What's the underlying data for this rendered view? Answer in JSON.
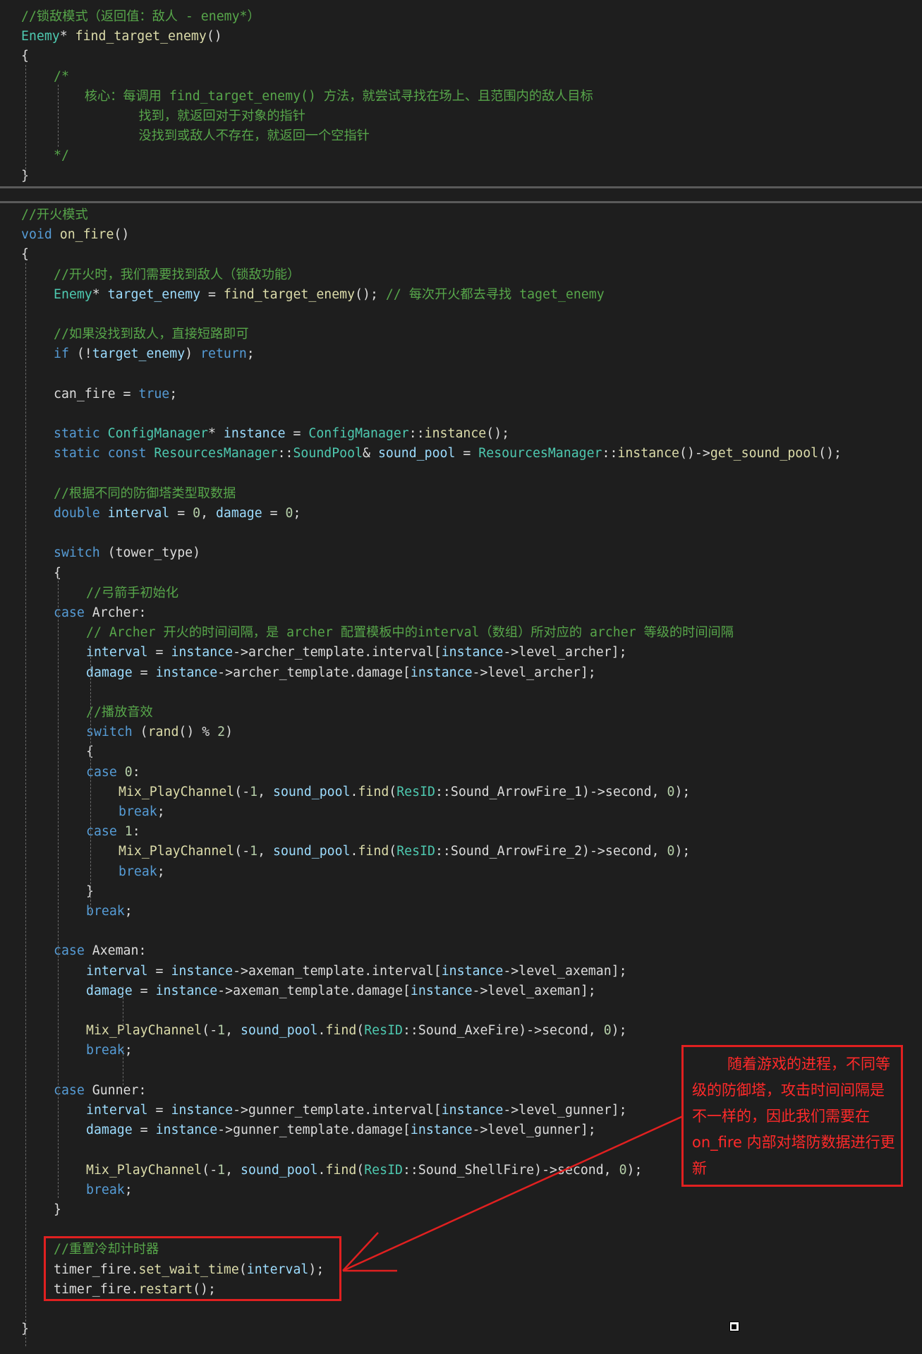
{
  "colors": {
    "background": "#1e1e1e",
    "comment": "#57a64a",
    "keyword": "#569cd6",
    "type": "#4ec9b0",
    "function": "#dcdcaa",
    "variable": "#9cdcfe",
    "plain": "#dcdcdc",
    "number": "#b5cea8",
    "annotation": "#ff2a2a"
  },
  "code_top": [
    {
      "indent": 0,
      "tokens": [
        [
          "comment",
          "//锁敌模式（返回值：敌人 - enemy*）"
        ]
      ]
    },
    {
      "indent": 0,
      "tokens": [
        [
          "type",
          "Enemy"
        ],
        [
          "plain",
          "* "
        ],
        [
          "function",
          "find_target_enemy"
        ],
        [
          "plain",
          "()"
        ]
      ]
    },
    {
      "indent": 0,
      "tokens": [
        [
          "plain",
          "{"
        ]
      ]
    },
    {
      "indent": 1,
      "tokens": [
        [
          "comment",
          "/*"
        ]
      ]
    },
    {
      "indent": 1,
      "tokens": [
        [
          "comment",
          "    核心：每调用 find_target_enemy() 方法，就尝试寻找在场上、且范围内的敌人目标"
        ]
      ]
    },
    {
      "indent": 1,
      "tokens": [
        [
          "comment",
          "           找到，就返回对于对象的指针"
        ]
      ]
    },
    {
      "indent": 1,
      "tokens": [
        [
          "comment",
          "           没找到或敌人不存在，就返回一个空指针"
        ]
      ]
    },
    {
      "indent": 1,
      "tokens": [
        [
          "comment",
          "*/"
        ]
      ]
    },
    {
      "indent": 0,
      "tokens": [
        [
          "plain",
          "}"
        ]
      ]
    }
  ],
  "code_bottom": [
    {
      "indent": 0,
      "tokens": [
        [
          "comment",
          "//开火模式"
        ]
      ]
    },
    {
      "indent": 0,
      "tokens": [
        [
          "keyword",
          "void "
        ],
        [
          "function",
          "on_fire"
        ],
        [
          "plain",
          "()"
        ]
      ]
    },
    {
      "indent": 0,
      "tokens": [
        [
          "plain",
          "{"
        ]
      ]
    },
    {
      "indent": 1,
      "tokens": [
        [
          "comment",
          "//开火时，我们需要找到敌人（锁敌功能）"
        ]
      ]
    },
    {
      "indent": 1,
      "tokens": [
        [
          "type",
          "Enemy"
        ],
        [
          "plain",
          "* "
        ],
        [
          "variable",
          "target_enemy"
        ],
        [
          "plain",
          " = "
        ],
        [
          "function",
          "find_target_enemy"
        ],
        [
          "plain",
          "(); "
        ],
        [
          "comment",
          "// 每次开火都去寻找 taget_enemy"
        ]
      ]
    },
    {
      "indent": 1,
      "tokens": []
    },
    {
      "indent": 1,
      "tokens": [
        [
          "comment",
          "//如果没找到敌人，直接短路即可"
        ]
      ]
    },
    {
      "indent": 1,
      "tokens": [
        [
          "keyword",
          "if "
        ],
        [
          "plain",
          "(!"
        ],
        [
          "variable",
          "target_enemy"
        ],
        [
          "plain",
          ") "
        ],
        [
          "keyword",
          "return"
        ],
        [
          "plain",
          ";"
        ]
      ]
    },
    {
      "indent": 1,
      "tokens": []
    },
    {
      "indent": 1,
      "tokens": [
        [
          "plain",
          "can_fire = "
        ],
        [
          "keyword",
          "true"
        ],
        [
          "plain",
          ";"
        ]
      ]
    },
    {
      "indent": 1,
      "tokens": []
    },
    {
      "indent": 1,
      "tokens": [
        [
          "keyword",
          "static "
        ],
        [
          "type",
          "ConfigManager"
        ],
        [
          "plain",
          "* "
        ],
        [
          "variable",
          "instance"
        ],
        [
          "plain",
          " = "
        ],
        [
          "type",
          "ConfigManager"
        ],
        [
          "plain",
          "::"
        ],
        [
          "function",
          "instance"
        ],
        [
          "plain",
          "();"
        ]
      ]
    },
    {
      "indent": 1,
      "tokens": [
        [
          "keyword",
          "static const "
        ],
        [
          "type",
          "ResourcesManager"
        ],
        [
          "plain",
          "::"
        ],
        [
          "type",
          "SoundPool"
        ],
        [
          "plain",
          "& "
        ],
        [
          "variable",
          "sound_pool"
        ],
        [
          "plain",
          " = "
        ],
        [
          "type",
          "ResourcesManager"
        ],
        [
          "plain",
          "::"
        ],
        [
          "function",
          "instance"
        ],
        [
          "plain",
          "()->"
        ],
        [
          "function",
          "get_sound_pool"
        ],
        [
          "plain",
          "();"
        ]
      ]
    },
    {
      "indent": 1,
      "tokens": []
    },
    {
      "indent": 1,
      "tokens": [
        [
          "comment",
          "//根据不同的防御塔类型取数据"
        ]
      ]
    },
    {
      "indent": 1,
      "tokens": [
        [
          "keyword",
          "double "
        ],
        [
          "variable",
          "interval"
        ],
        [
          "plain",
          " = "
        ],
        [
          "number",
          "0"
        ],
        [
          "plain",
          ", "
        ],
        [
          "variable",
          "damage"
        ],
        [
          "plain",
          " = "
        ],
        [
          "number",
          "0"
        ],
        [
          "plain",
          ";"
        ]
      ]
    },
    {
      "indent": 1,
      "tokens": []
    },
    {
      "indent": 1,
      "tokens": [
        [
          "keyword",
          "switch "
        ],
        [
          "plain",
          "(tower_type)"
        ]
      ]
    },
    {
      "indent": 1,
      "tokens": [
        [
          "plain",
          "{"
        ]
      ]
    },
    {
      "indent": 2,
      "tokens": [
        [
          "comment",
          "//弓箭手初始化"
        ]
      ]
    },
    {
      "indent": 1,
      "tokens": [
        [
          "keyword",
          "case "
        ],
        [
          "plain",
          "Archer:"
        ]
      ]
    },
    {
      "indent": 2,
      "tokens": [
        [
          "comment",
          "// Archer 开火的时间间隔，是 archer 配置模板中的interval（数组）所对应的 archer 等级的时间间隔"
        ]
      ]
    },
    {
      "indent": 2,
      "tokens": [
        [
          "variable",
          "interval"
        ],
        [
          "plain",
          " = "
        ],
        [
          "variable",
          "instance"
        ],
        [
          "plain",
          "->archer_template.interval["
        ],
        [
          "variable",
          "instance"
        ],
        [
          "plain",
          "->level_archer];"
        ]
      ]
    },
    {
      "indent": 2,
      "tokens": [
        [
          "variable",
          "damage"
        ],
        [
          "plain",
          " = "
        ],
        [
          "variable",
          "instance"
        ],
        [
          "plain",
          "->archer_template.damage["
        ],
        [
          "variable",
          "instance"
        ],
        [
          "plain",
          "->level_archer];"
        ]
      ]
    },
    {
      "indent": 2,
      "tokens": []
    },
    {
      "indent": 2,
      "tokens": [
        [
          "comment",
          "//播放音效"
        ]
      ]
    },
    {
      "indent": 2,
      "tokens": [
        [
          "keyword",
          "switch "
        ],
        [
          "plain",
          "("
        ],
        [
          "function",
          "rand"
        ],
        [
          "plain",
          "() % "
        ],
        [
          "number",
          "2"
        ],
        [
          "plain",
          ")"
        ]
      ]
    },
    {
      "indent": 2,
      "tokens": [
        [
          "plain",
          "{"
        ]
      ]
    },
    {
      "indent": 2,
      "tokens": [
        [
          "keyword",
          "case "
        ],
        [
          "number",
          "0"
        ],
        [
          "plain",
          ":"
        ]
      ]
    },
    {
      "indent": 3,
      "tokens": [
        [
          "function",
          "Mix_PlayChannel"
        ],
        [
          "plain",
          "(-"
        ],
        [
          "number",
          "1"
        ],
        [
          "plain",
          ", "
        ],
        [
          "variable",
          "sound_pool"
        ],
        [
          "plain",
          "."
        ],
        [
          "function",
          "find"
        ],
        [
          "plain",
          "("
        ],
        [
          "type",
          "ResID"
        ],
        [
          "plain",
          "::Sound_ArrowFire_1)->second, "
        ],
        [
          "number",
          "0"
        ],
        [
          "plain",
          ");"
        ]
      ]
    },
    {
      "indent": 3,
      "tokens": [
        [
          "keyword",
          "break"
        ],
        [
          "plain",
          ";"
        ]
      ]
    },
    {
      "indent": 2,
      "tokens": [
        [
          "keyword",
          "case "
        ],
        [
          "number",
          "1"
        ],
        [
          "plain",
          ":"
        ]
      ]
    },
    {
      "indent": 3,
      "tokens": [
        [
          "function",
          "Mix_PlayChannel"
        ],
        [
          "plain",
          "(-"
        ],
        [
          "number",
          "1"
        ],
        [
          "plain",
          ", "
        ],
        [
          "variable",
          "sound_pool"
        ],
        [
          "plain",
          "."
        ],
        [
          "function",
          "find"
        ],
        [
          "plain",
          "("
        ],
        [
          "type",
          "ResID"
        ],
        [
          "plain",
          "::Sound_ArrowFire_2)->second, "
        ],
        [
          "number",
          "0"
        ],
        [
          "plain",
          ");"
        ]
      ]
    },
    {
      "indent": 3,
      "tokens": [
        [
          "keyword",
          "break"
        ],
        [
          "plain",
          ";"
        ]
      ]
    },
    {
      "indent": 2,
      "tokens": [
        [
          "plain",
          "}"
        ]
      ]
    },
    {
      "indent": 2,
      "tokens": [
        [
          "keyword",
          "break"
        ],
        [
          "plain",
          ";"
        ]
      ]
    },
    {
      "indent": 1,
      "tokens": []
    },
    {
      "indent": 1,
      "tokens": [
        [
          "keyword",
          "case "
        ],
        [
          "plain",
          "Axeman:"
        ]
      ]
    },
    {
      "indent": 2,
      "tokens": [
        [
          "variable",
          "interval"
        ],
        [
          "plain",
          " = "
        ],
        [
          "variable",
          "instance"
        ],
        [
          "plain",
          "->axeman_template.interval["
        ],
        [
          "variable",
          "instance"
        ],
        [
          "plain",
          "->level_axeman];"
        ]
      ]
    },
    {
      "indent": 2,
      "tokens": [
        [
          "variable",
          "damage"
        ],
        [
          "plain",
          " = "
        ],
        [
          "variable",
          "instance"
        ],
        [
          "plain",
          "->axeman_template.damage["
        ],
        [
          "variable",
          "instance"
        ],
        [
          "plain",
          "->level_axeman];"
        ]
      ]
    },
    {
      "indent": 2,
      "tokens": []
    },
    {
      "indent": 2,
      "tokens": [
        [
          "function",
          "Mix_PlayChannel"
        ],
        [
          "plain",
          "(-"
        ],
        [
          "number",
          "1"
        ],
        [
          "plain",
          ", "
        ],
        [
          "variable",
          "sound_pool"
        ],
        [
          "plain",
          "."
        ],
        [
          "function",
          "find"
        ],
        [
          "plain",
          "("
        ],
        [
          "type",
          "ResID"
        ],
        [
          "plain",
          "::Sound_AxeFire)->second, "
        ],
        [
          "number",
          "0"
        ],
        [
          "plain",
          ");"
        ]
      ]
    },
    {
      "indent": 2,
      "tokens": [
        [
          "keyword",
          "break"
        ],
        [
          "plain",
          ";"
        ]
      ]
    },
    {
      "indent": 1,
      "tokens": []
    },
    {
      "indent": 1,
      "tokens": [
        [
          "keyword",
          "case "
        ],
        [
          "plain",
          "Gunner:"
        ]
      ]
    },
    {
      "indent": 2,
      "tokens": [
        [
          "variable",
          "interval"
        ],
        [
          "plain",
          " = "
        ],
        [
          "variable",
          "instance"
        ],
        [
          "plain",
          "->gunner_template.interval["
        ],
        [
          "variable",
          "instance"
        ],
        [
          "plain",
          "->level_gunner];"
        ]
      ]
    },
    {
      "indent": 2,
      "tokens": [
        [
          "variable",
          "damage"
        ],
        [
          "plain",
          " = "
        ],
        [
          "variable",
          "instance"
        ],
        [
          "plain",
          "->gunner_template.damage["
        ],
        [
          "variable",
          "instance"
        ],
        [
          "plain",
          "->level_gunner];"
        ]
      ]
    },
    {
      "indent": 2,
      "tokens": []
    },
    {
      "indent": 2,
      "tokens": [
        [
          "function",
          "Mix_PlayChannel"
        ],
        [
          "plain",
          "(-"
        ],
        [
          "number",
          "1"
        ],
        [
          "plain",
          ", "
        ],
        [
          "variable",
          "sound_pool"
        ],
        [
          "plain",
          "."
        ],
        [
          "function",
          "find"
        ],
        [
          "plain",
          "("
        ],
        [
          "type",
          "ResID"
        ],
        [
          "plain",
          "::Sound_ShellFire)->second, "
        ],
        [
          "number",
          "0"
        ],
        [
          "plain",
          ");"
        ]
      ]
    },
    {
      "indent": 2,
      "tokens": [
        [
          "keyword",
          "break"
        ],
        [
          "plain",
          ";"
        ]
      ]
    },
    {
      "indent": 1,
      "tokens": [
        [
          "plain",
          "}"
        ]
      ]
    },
    {
      "indent": 1,
      "tokens": []
    },
    {
      "indent": 1,
      "tokens": [
        [
          "comment",
          "//重置冷却计时器"
        ]
      ]
    },
    {
      "indent": 1,
      "tokens": [
        [
          "plain",
          "timer_fire."
        ],
        [
          "function",
          "set_wait_time"
        ],
        [
          "plain",
          "("
        ],
        [
          "variable",
          "interval"
        ],
        [
          "plain",
          ");"
        ]
      ]
    },
    {
      "indent": 1,
      "tokens": [
        [
          "plain",
          "timer_fire."
        ],
        [
          "function",
          "restart"
        ],
        [
          "plain",
          "();"
        ]
      ]
    },
    {
      "indent": 1,
      "tokens": []
    },
    {
      "indent": 0,
      "tokens": [
        [
          "plain",
          "}"
        ]
      ]
    }
  ],
  "annotation": {
    "text": "随着游戏的进程，不同等级的防御塔，攻击时间间隔是不一样的，因此我们需要在 on_fire 内部对塔防数据进行更新"
  }
}
